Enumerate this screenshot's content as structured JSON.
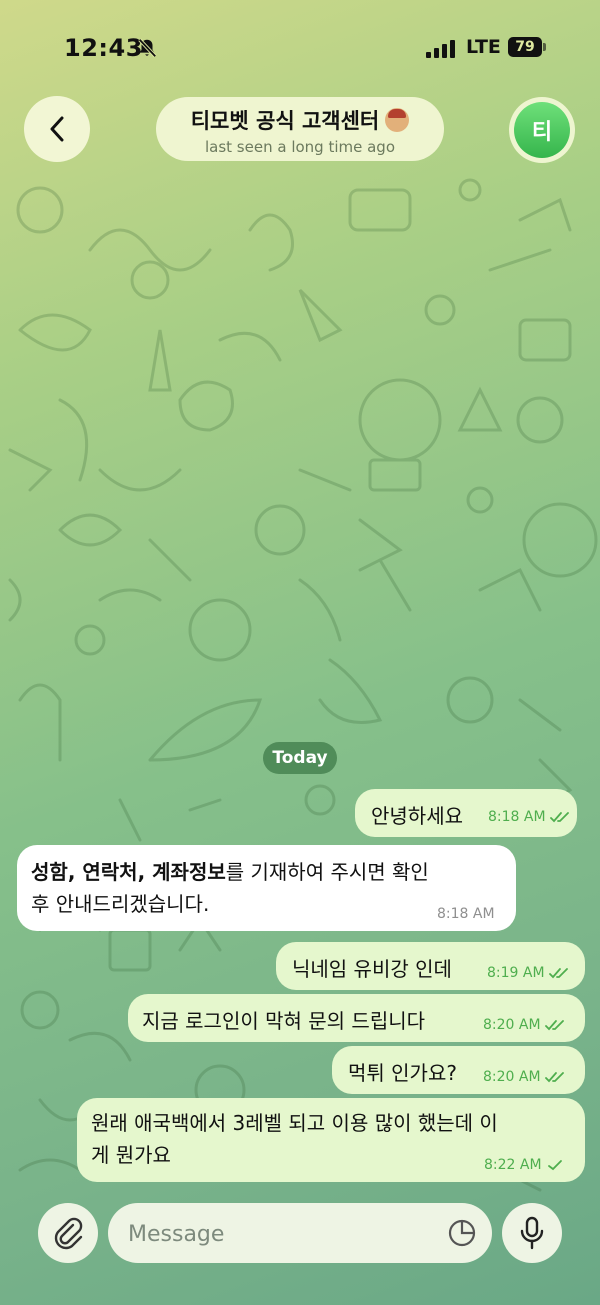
{
  "status_bar": {
    "time": "12:43",
    "network": "LTE",
    "battery": "79"
  },
  "header": {
    "title": "티모벳 공식 고객센터",
    "subtitle": "last seen a long time ago",
    "avatar_initial": "티"
  },
  "date_chip": "Today",
  "messages": [
    {
      "dir": "out",
      "text": "안녕하세요",
      "time": "8:18 AM",
      "status": "read"
    },
    {
      "dir": "in",
      "text_bold_1": "성함",
      "sep_1": ", ",
      "text_bold_2": "연락처",
      "sep_2": ", ",
      "text_bold_3": "계좌정보",
      "text_rest_1": "를 기재하여 주시면 확인",
      "text_rest_2": "후 안내드리겠습니다.",
      "time": "8:18 AM"
    },
    {
      "dir": "out",
      "text": "닉네임 유비강 인데",
      "time": "8:19 AM",
      "status": "read"
    },
    {
      "dir": "out",
      "text": "지금 로그인이 막혀 문의 드립니다",
      "time": "8:20 AM",
      "status": "read"
    },
    {
      "dir": "out",
      "text": "먹튀 인가요?",
      "time": "8:20 AM",
      "status": "read"
    },
    {
      "dir": "out",
      "text_line1": "원래 애국백에서 3레벨 되고 이용 많이 했는데 이",
      "text_line2": "게 뭔가요",
      "time": "8:22 AM",
      "status": "sent"
    }
  ],
  "input": {
    "placeholder": "Message"
  },
  "icons": {
    "back": "chevron-left-icon",
    "attach": "paperclip-icon",
    "sticker": "sticker-icon",
    "mic": "microphone-icon",
    "mute": "bell-slash-icon"
  }
}
